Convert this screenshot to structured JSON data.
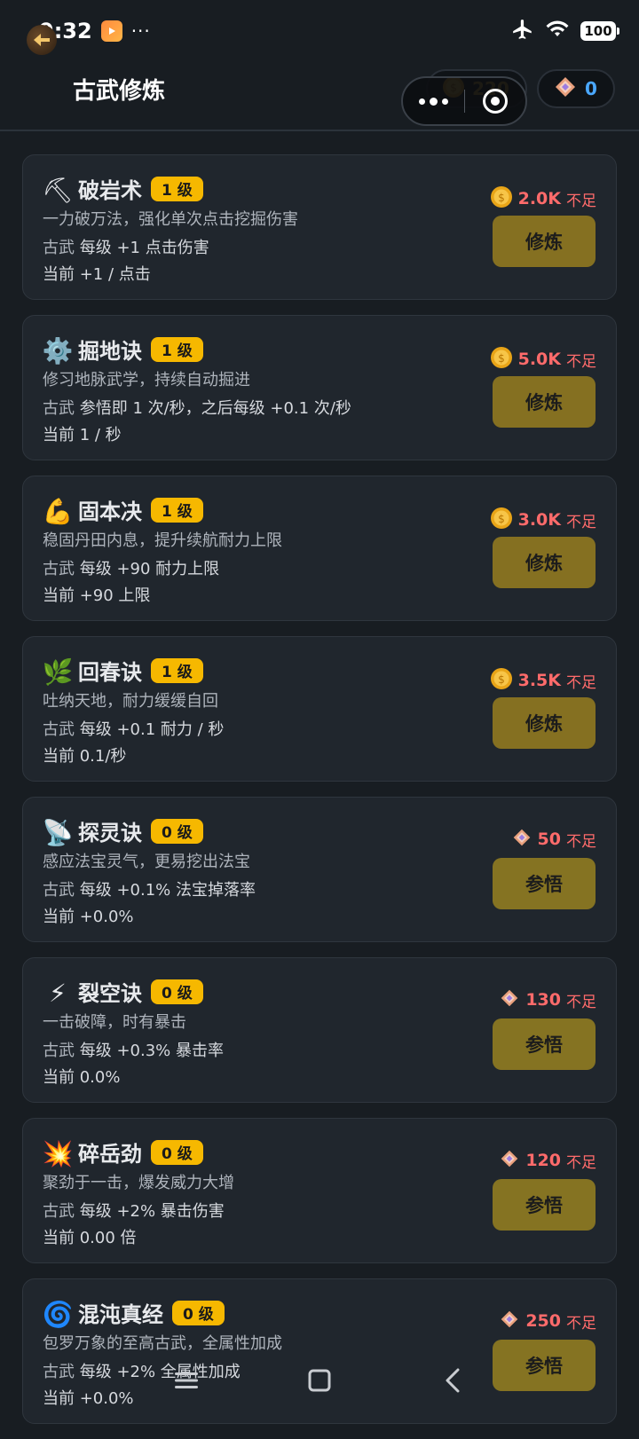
{
  "status_bar": {
    "time": "9:32",
    "more": "···",
    "battery": "100"
  },
  "header": {
    "title": "古武修炼",
    "coins": "220",
    "gems": "0"
  },
  "colors": {
    "accent_gold": "#f6b800",
    "button_bg": "#857021",
    "insufficient": "#ff6b6b",
    "card_bg": "#20262d",
    "page_bg": "#181d22"
  },
  "skills": [
    {
      "icon": "pickaxe-icon",
      "glyph": "⛏",
      "name": "破岩术",
      "level": "1 级",
      "desc": "一力破万法，强化单次点击挖掘伤害",
      "stat_prefix": "古武",
      "stat": " 每级 +1 点击伤害",
      "current": "当前 +1 / 点击",
      "cost_type": "coin",
      "cost": "2.0K",
      "note": "不足",
      "button": "修炼"
    },
    {
      "icon": "gear-icon",
      "glyph": "⚙️",
      "name": "掘地诀",
      "level": "1 级",
      "desc": "修习地脉武学，持续自动掘进",
      "stat_prefix": "古武",
      "stat": " 参悟即 1 次/秒，之后每级 +0.1 次/秒",
      "current": "当前 1 / 秒",
      "cost_type": "coin",
      "cost": "5.0K",
      "note": "不足",
      "button": "修炼"
    },
    {
      "icon": "muscle-icon",
      "glyph": "💪",
      "name": "固本决",
      "level": "1 级",
      "desc": "稳固丹田内息，提升续航耐力上限",
      "stat_prefix": "古武",
      "stat": " 每级 +90 耐力上限",
      "current": "当前 +90 上限",
      "cost_type": "coin",
      "cost": "3.0K",
      "note": "不足",
      "button": "修炼"
    },
    {
      "icon": "herb-icon",
      "glyph": "🌿",
      "name": "回春诀",
      "level": "1 级",
      "desc": "吐纳天地，耐力缓缓自回",
      "stat_prefix": "古武",
      "stat": " 每级 +0.1 耐力 / 秒",
      "current": "当前 0.1/秒",
      "cost_type": "coin",
      "cost": "3.5K",
      "note": "不足",
      "button": "修炼"
    },
    {
      "icon": "satellite-dish-icon",
      "glyph": "📡",
      "name": "探灵诀",
      "level": "0 级",
      "desc": "感应法宝灵气，更易挖出法宝",
      "stat_prefix": "古武",
      "stat": " 每级 +0.1% 法宝掉落率",
      "current": "当前 +0.0%",
      "cost_type": "gem",
      "cost": "50",
      "note": "不足",
      "button": "参悟"
    },
    {
      "icon": "lightning-icon",
      "glyph": "⚡",
      "name": "裂空诀",
      "level": "0 级",
      "desc": "一击破障，时有暴击",
      "stat_prefix": "古武",
      "stat": " 每级 +0.3% 暴击率",
      "current": "当前 0.0%",
      "cost_type": "gem",
      "cost": "130",
      "note": "不足",
      "button": "参悟"
    },
    {
      "icon": "burst-icon",
      "glyph": "💥",
      "name": "碎岳劲",
      "level": "0 级",
      "desc": "聚劲于一击，爆发威力大增",
      "stat_prefix": "古武",
      "stat": " 每级 +2% 暴击伤害",
      "current": "当前 0.00 倍",
      "cost_type": "gem",
      "cost": "120",
      "note": "不足",
      "button": "参悟"
    },
    {
      "icon": "spiral-icon",
      "glyph": "🌀",
      "name": "混沌真经",
      "level": "0 级",
      "desc": "包罗万象的至高古武，全属性加成",
      "stat_prefix": "古武",
      "stat": " 每级 +2% 全属性加成",
      "current": "当前 +0.0%",
      "cost_type": "gem",
      "cost": "250",
      "note": "不足",
      "button": "参悟"
    }
  ]
}
